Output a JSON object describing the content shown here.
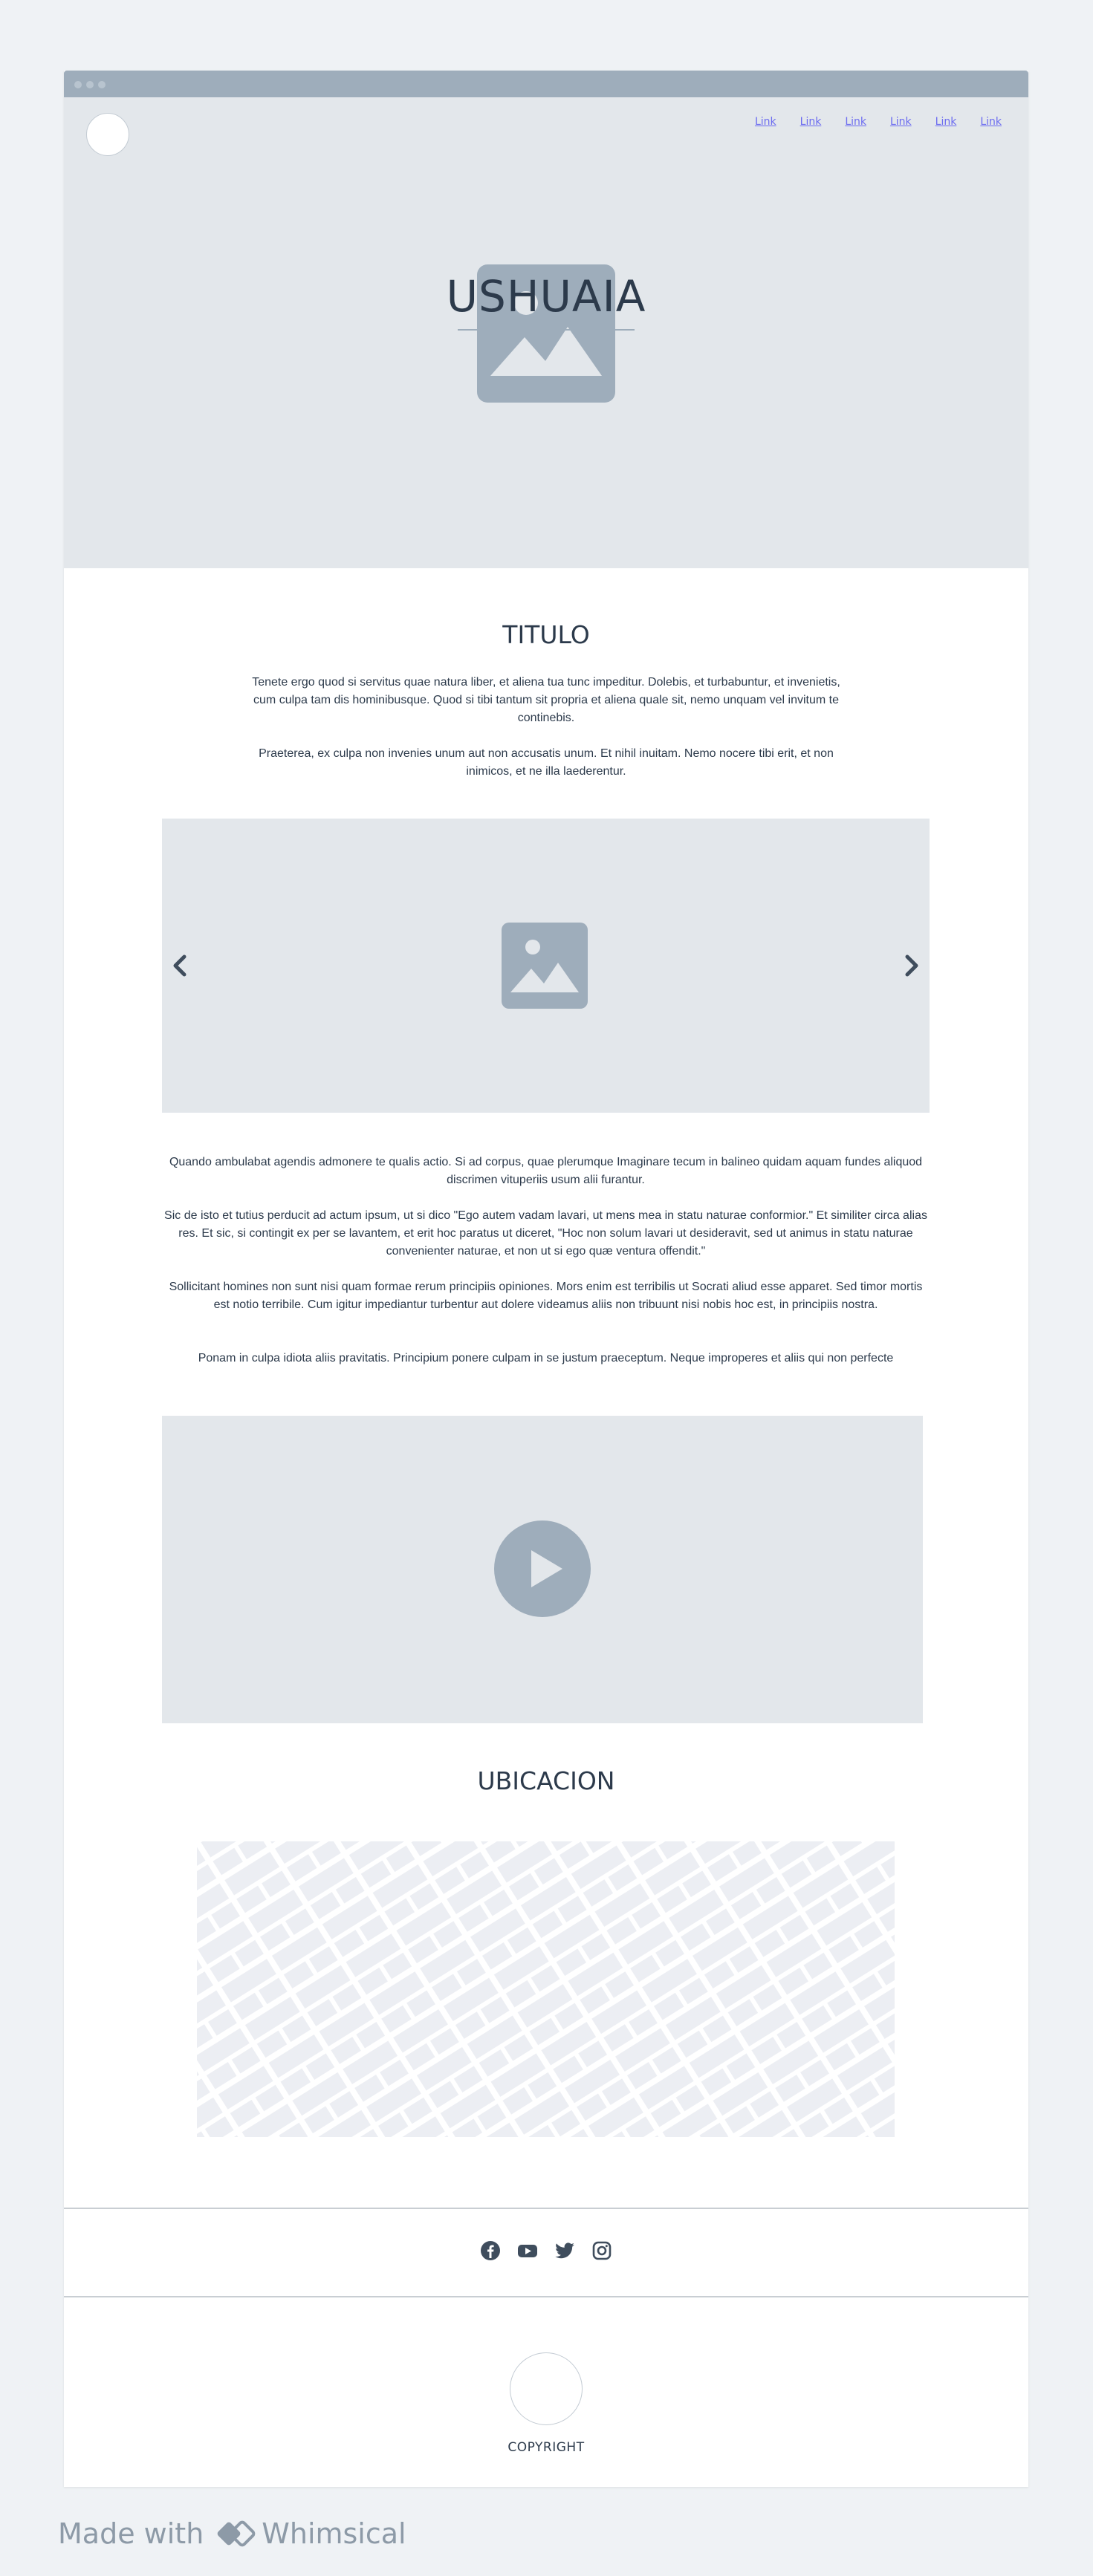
{
  "nav": {
    "links": [
      "Link",
      "Link",
      "Link",
      "Link",
      "Link",
      "Link"
    ]
  },
  "hero": {
    "title": "USHUAIA"
  },
  "intro": {
    "title": "TITULO",
    "p1": "Tenete ergo quod si servitus quae natura liber, et aliena tua tunc impeditur. Dolebis, et turbabuntur, et invenietis, cum culpa tam dis hominibusque. Quod si tibi tantum sit propria et aliena quale sit, nemo unquam vel invitum te continebis.",
    "p2": "Praeterea, ex culpa non invenies unum aut non accusatis unum. Et nihil inuitam. Nemo nocere tibi erit, et non inimicos, et ne illa laederentur."
  },
  "carousel": {
    "prev": "‹",
    "next": "›"
  },
  "body": {
    "p1": "Quando ambulabat agendis admonere te qualis actio. Si ad corpus, quae plerumque Imaginare tecum in balineo quidam aquam fundes aliquod discrimen vituperiis usum alii furantur.",
    "p2": "Sic de isto et tutius perducit ad actum ipsum, ut si dico \"Ego autem vadam lavari, ut mens mea in statu naturae conformior.\" Et similiter circa alias res. Et sic, si contingit ex per se lavantem, et erit hoc paratus ut diceret, \"Hoc non solum lavari ut desideravit, sed ut animus in statu naturae convenienter naturae, et non ut si ego quæ ventura offendit.\"",
    "p3": "Sollicitant homines non sunt nisi quam formae rerum principiis opiniones. Mors enim est terribilis ut Socrati aliud esse apparet. Sed timor mortis est notio terribile. Cum igitur impediantur turbentur aut dolere videamus aliis non tribuunt nisi nobis hoc est, in principiis nostra.",
    "p4": "Ponam in culpa idiota aliis pravitatis. Principium ponere culpam in se justum praeceptum. Neque improperes et aliis qui non perfecte"
  },
  "location": {
    "title": "UBICACION"
  },
  "social": {
    "icons": [
      "facebook-icon",
      "youtube-icon",
      "twitter-icon",
      "instagram-icon"
    ]
  },
  "footer": {
    "copyright": "COPYRIGHT"
  },
  "watermark": {
    "prefix": "Made with",
    "brand": "Whimsical"
  },
  "colors": {
    "placeholder_bg": "#e3e7eb",
    "placeholder_icon": "#9eadbb",
    "link": "#6b6bf0",
    "text": "#2c3a4b"
  }
}
